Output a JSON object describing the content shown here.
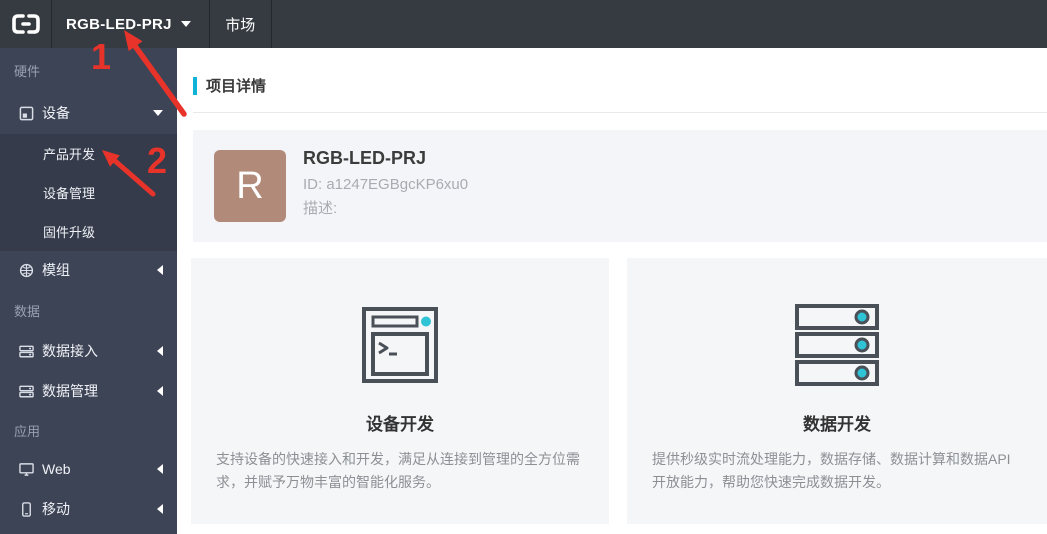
{
  "topbar": {
    "project_name": "RGB-LED-PRJ",
    "market_label": "市场"
  },
  "sidebar": {
    "sections": [
      {
        "label": "硬件"
      },
      {
        "label": "数据"
      },
      {
        "label": "应用"
      }
    ],
    "items": [
      {
        "label": "设备",
        "icon": "device-icon",
        "expanded": true
      },
      {
        "label": "模组",
        "icon": "module-icon",
        "expanded": false
      },
      {
        "label": "数据接入",
        "icon": "database-icon",
        "expanded": false
      },
      {
        "label": "数据管理",
        "icon": "database-icon",
        "expanded": false
      },
      {
        "label": "Web",
        "icon": "monitor-icon",
        "expanded": false
      },
      {
        "label": "移动",
        "icon": "phone-icon",
        "expanded": false
      }
    ],
    "device_submenu": [
      {
        "label": "产品开发"
      },
      {
        "label": "设备管理"
      },
      {
        "label": "固件升级"
      }
    ]
  },
  "main": {
    "page_title": "项目详情",
    "project_card": {
      "avatar_letter": "R",
      "name": "RGB-LED-PRJ",
      "id_text": "ID: a1247EGBgcKP6xu0",
      "description_label": "描述:"
    },
    "dev_cards": [
      {
        "title": "设备开发",
        "description": "支持设备的快速接入和开发，满足从连接到管理的全方位需求，并赋予万物丰富的智能化服务。"
      },
      {
        "title": "数据开发",
        "description": "提供秒级实时流处理能力，数据存储、数据计算和数据API开放能力，帮助您快速完成数据开发。"
      }
    ]
  },
  "annotations": {
    "step_1": "1",
    "step_2": "2",
    "arrow_color": "#e8332a"
  },
  "colors": {
    "topbar_bg": "#363b41",
    "sidebar_bg": "#3d4455",
    "submenu_bg": "#353b4a",
    "accent_cyan": "#0fb3d8",
    "icon_teal": "#2fc3d6",
    "avatar_brown": "#b18a7a",
    "card_bg": "#f5f6f8"
  }
}
